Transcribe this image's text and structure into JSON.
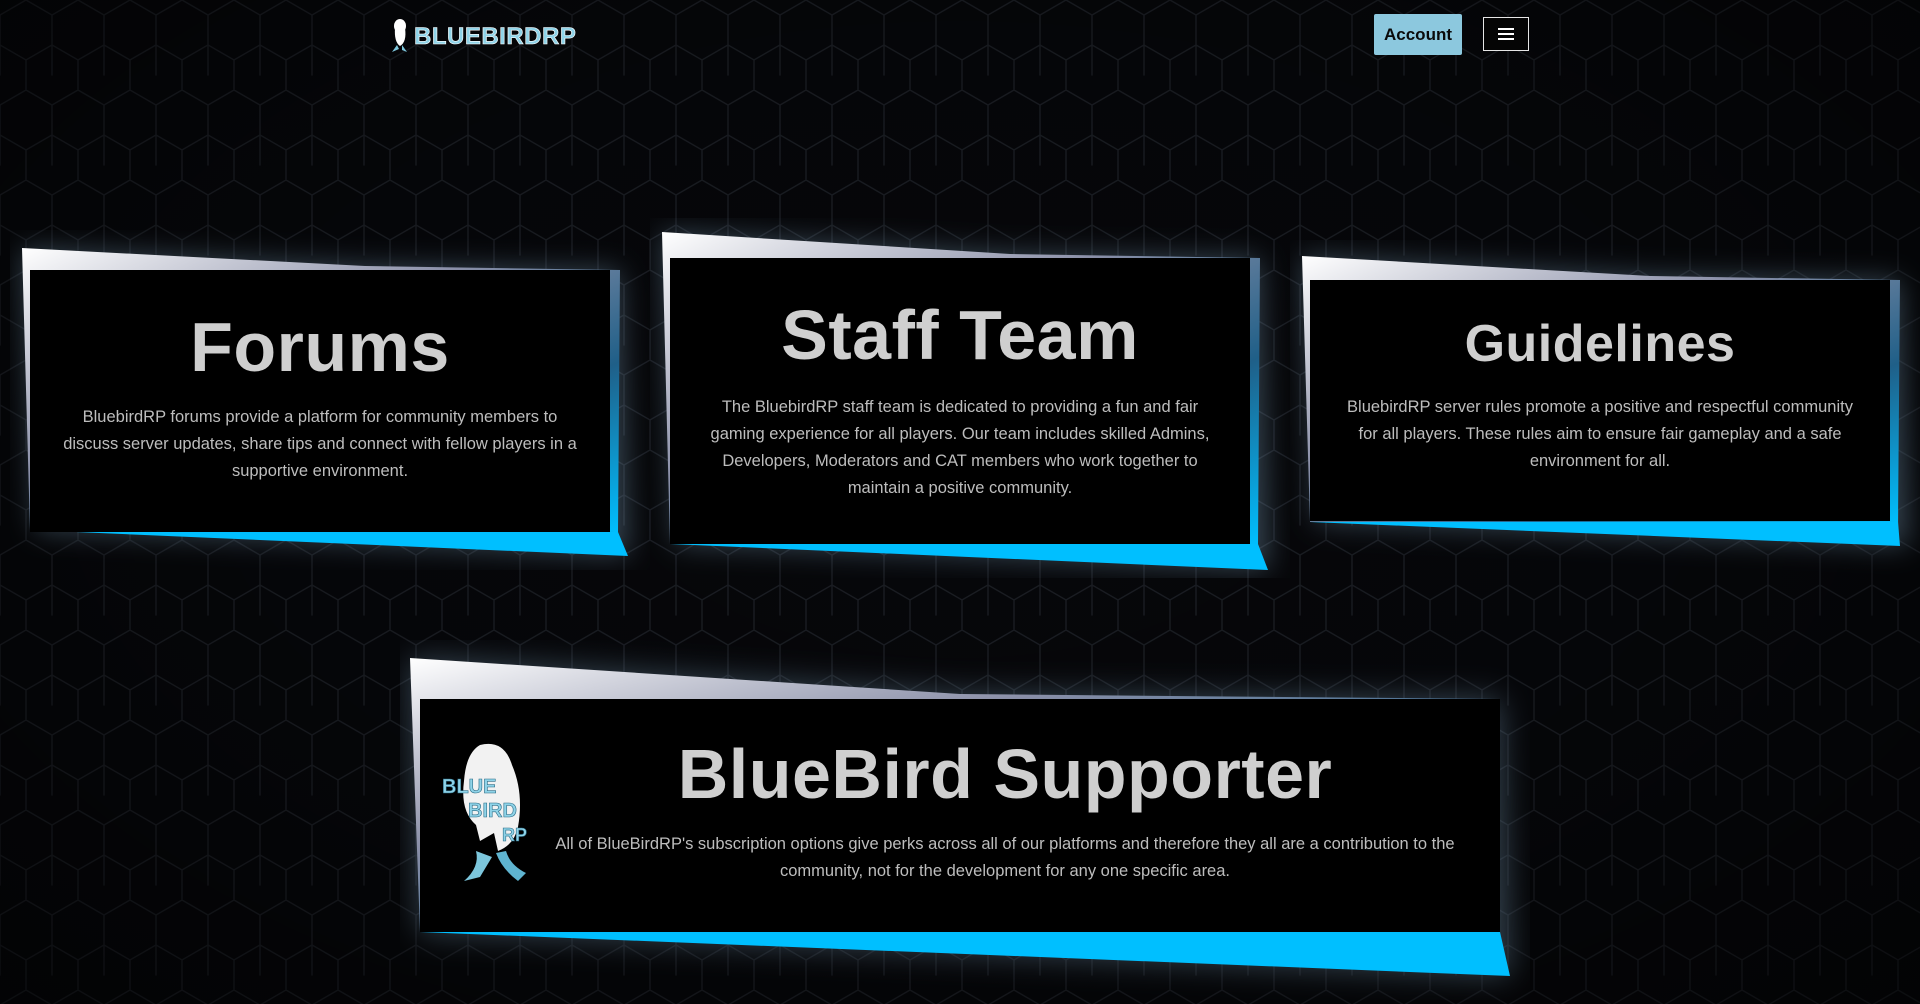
{
  "header": {
    "logo_text": "BLUEBIRDRP",
    "account_label": "Account",
    "menu_icon": "hamburger-menu-icon"
  },
  "cards": {
    "forums": {
      "title": "Forums",
      "text": "BluebirdRP forums provide a platform for community members to discuss server updates, share tips and connect with fellow players in a supportive environment."
    },
    "staff": {
      "title": "Staff Team",
      "text": "The BluebirdRP staff team is dedicated to providing a fun and fair gaming experience for all players. Our team includes skilled Admins, Developers, Moderators and CAT members who work together to maintain a positive community."
    },
    "guidelines": {
      "title": "Guidelines",
      "text": "BluebirdRP server rules promote a positive and respectful community for all players. These rules aim to ensure fair gameplay and a safe environment for all."
    },
    "supporter": {
      "title": "BlueBird Supporter",
      "text": "All of BlueBirdRP's subscription options give perks across all of our platforms and therefore they all are a contribution to the community, not for the development for any one specific area.",
      "logo_text": [
        "BLUE",
        "BIRD",
        "RP"
      ]
    }
  },
  "colors": {
    "accent_blue": "#00bfff",
    "account_button": "#8cc8de",
    "card_bg": "#000000",
    "page_bg": "#050608",
    "title_text": "#cfcfcf"
  }
}
